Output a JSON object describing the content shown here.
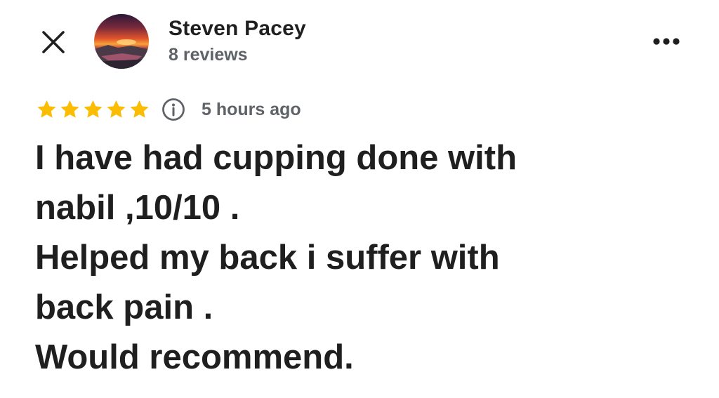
{
  "header": {
    "reviewer_name": "Steven Pacey",
    "review_count": "8 reviews",
    "close_icon": "close-icon",
    "more_icon": "more-horizontal-icon"
  },
  "review": {
    "rating": 5,
    "max_rating": 5,
    "time_ago": "5 hours ago",
    "text": "I have had cupping done with\nnabil ,10/10 .\nHelped my back i suffer with\nback pain .\nWould recommend."
  },
  "colors": {
    "star": "#fbbc04",
    "text_primary": "#1f1f1f",
    "text_secondary": "#5f6368"
  }
}
